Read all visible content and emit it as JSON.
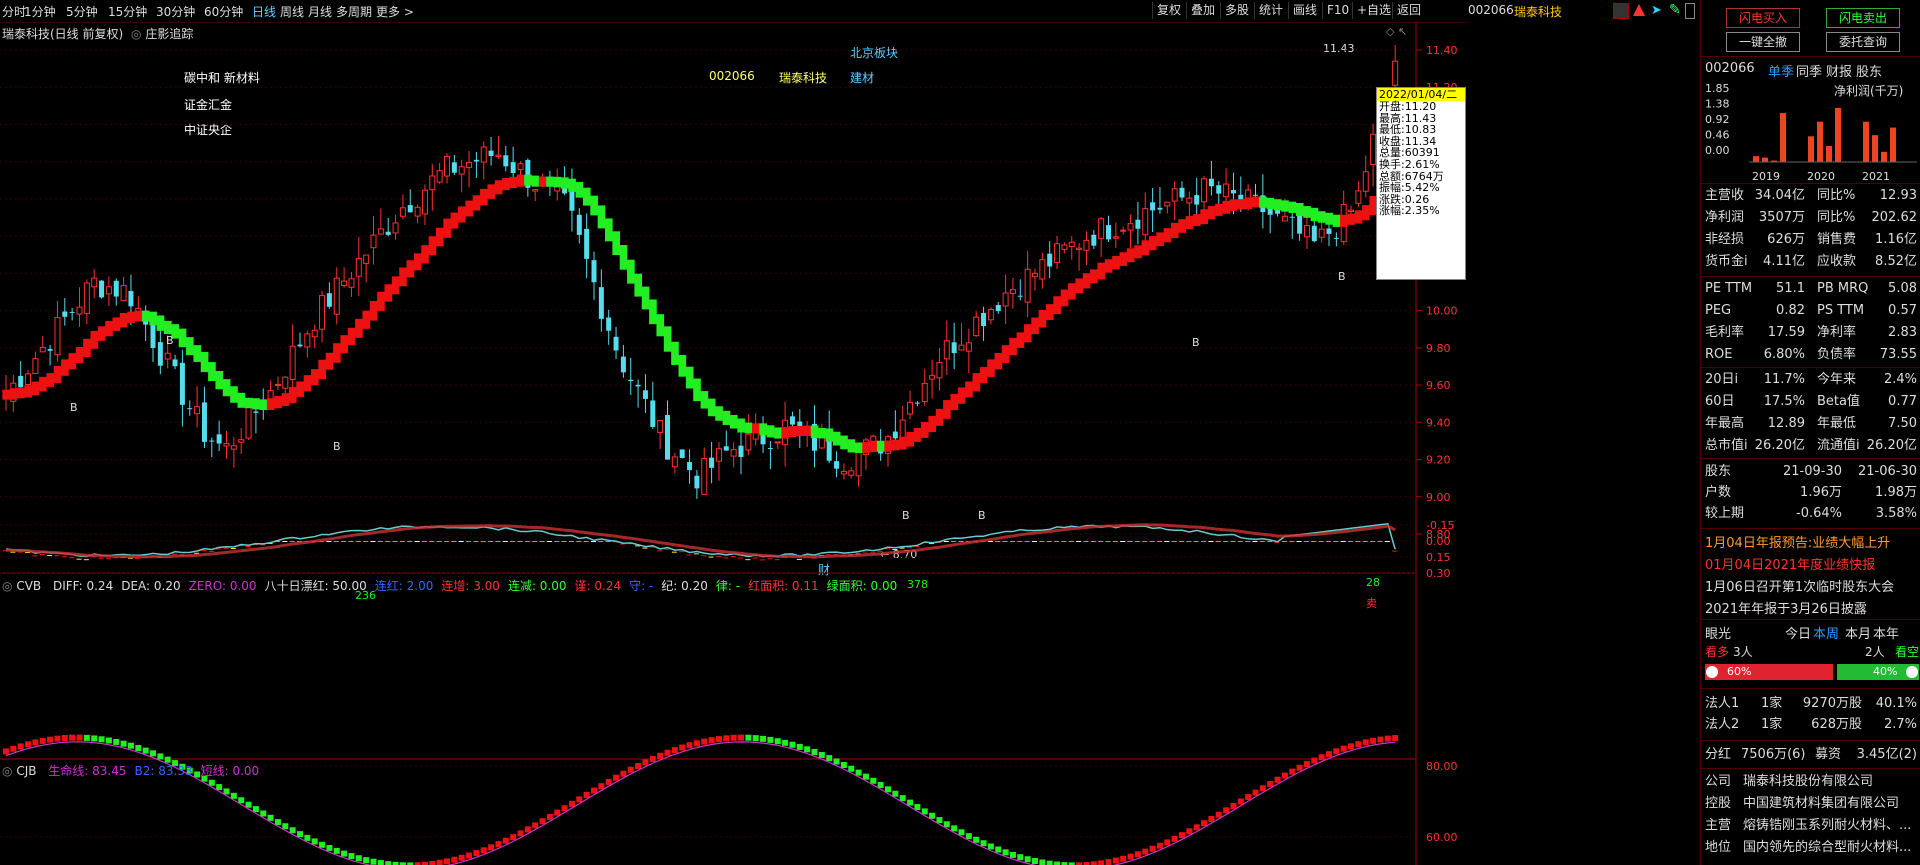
{
  "toolbar": {
    "periods": [
      "分时",
      "1分钟",
      "5分钟",
      "15分钟",
      "30分钟",
      "60分钟",
      "日线",
      "周线",
      "月线",
      "多周期",
      "更多 >"
    ],
    "right_buttons": [
      "复权",
      "叠加",
      "多股",
      "统计",
      "画线",
      "F10",
      "+自选",
      "返回"
    ],
    "stock_code": "002066",
    "stock_name": "瑞泰科技"
  },
  "main": {
    "title": "瑞泰科技(日线 前复权)",
    "zyzz": "庄影追踪",
    "tags_left": [
      "碳中和 新材料",
      "证金汇金",
      "中证央企"
    ],
    "tag_code": "002066",
    "tag_name": "瑞泰科技",
    "tag_sector": "建材",
    "tag_board": "北京板块",
    "high_label": "11.43",
    "low_label": "8.70",
    "cai_label": "财",
    "b_markers": [
      "B",
      "B",
      "B",
      "B",
      "B",
      "B",
      "B"
    ],
    "price_ticks": [
      "11.40",
      "11.20",
      "11.00",
      "10.80",
      "10.60",
      "10.40",
      "10.20",
      "10.00",
      "9.80",
      "9.60",
      "9.40",
      "9.20",
      "9.00",
      "8.80"
    ]
  },
  "tooltip": {
    "date": "2022/01/04/二",
    "rows": [
      "开盘:11.20",
      "最高:11.43",
      "最低:10.83",
      "收盘:11.34",
      "总量:60391",
      "换手:2.61%",
      "总额:6764万",
      "振幅:5.42%",
      "涨跌:0.26",
      "涨幅:2.35%"
    ]
  },
  "cvb": {
    "title": "CVB",
    "items": [
      {
        "t": "DIFF: 0.24",
        "c": "#dddddd"
      },
      {
        "t": "DEA: 0.20",
        "c": "#dddddd"
      },
      {
        "t": "ZERO: 0.00",
        "c": "#cc33cc"
      },
      {
        "t": "八十日漂红: 50.00",
        "c": "#dddddd"
      },
      {
        "t": "连红: 2.00",
        "c": "#3366ff"
      },
      {
        "t": "连增: 3.00",
        "c": "#ff3333"
      },
      {
        "t": "连减: 0.00",
        "c": "#33ff33"
      },
      {
        "t": "谨: 0.24",
        "c": "#ff3333"
      },
      {
        "t": "守: -",
        "c": "#3366ff"
      },
      {
        "t": "纪: 0.20",
        "c": "#dddddd"
      },
      {
        "t": "律: -",
        "c": "#33ff33"
      },
      {
        "t": "红面积: 0.11",
        "c": "#ff3333"
      },
      {
        "t": "绿面积: 0.00",
        "c": "#33ff33"
      }
    ],
    "ticks": [
      "0.30",
      "0.15",
      "0.00",
      "-0.15"
    ],
    "labels": [
      "236",
      "378",
      "28"
    ],
    "sell_label": "卖"
  },
  "cjb": {
    "title": "CJB",
    "items": [
      {
        "t": "生命线: 83.45",
        "c": "#cc33cc"
      },
      {
        "t": "B2: 83.33",
        "c": "#3366ff"
      },
      {
        "t": "短线: 0.00",
        "c": "#cc33cc"
      }
    ],
    "ticks": [
      "80.00",
      "60.00"
    ]
  },
  "panel": {
    "btn_buy": "闪电买入",
    "btn_sell": "闪电卖出",
    "btn_all": "一键全撤",
    "btn_query": "委托查询",
    "code": "002066",
    "tabs": [
      "单季",
      "同季",
      "财报",
      "股东"
    ],
    "chart_label": "净利润(千万)",
    "mini_y": [
      "1.85",
      "1.38",
      "0.92",
      "0.46",
      "0.00"
    ],
    "mini_x": [
      "2019",
      "2020",
      "2021"
    ],
    "fin": [
      [
        "主营收",
        "34.04亿",
        "同比%",
        "12.93"
      ],
      [
        "净利润",
        "3507万",
        "同比%",
        "202.62"
      ],
      [
        "非经损",
        "626万",
        "销售费",
        "1.16亿"
      ],
      [
        "货币金i",
        "4.11亿",
        "应收款",
        "8.52亿"
      ]
    ],
    "val": [
      [
        "PE TTM",
        "51.1",
        "PB MRQ",
        "5.08"
      ],
      [
        "PEG",
        "0.82",
        "PS TTM",
        "0.57"
      ],
      [
        "毛利率",
        "17.59",
        "净利率",
        "2.83"
      ],
      [
        "ROE",
        "6.80%",
        "负债率",
        "73.55"
      ]
    ],
    "perf": [
      [
        "20日i",
        "11.7%",
        "今年来",
        "2.4%"
      ],
      [
        "60日",
        "17.5%",
        "Beta值",
        "0.77"
      ],
      [
        "年最高",
        "12.89",
        "年最低",
        "7.50"
      ],
      [
        "总市值i",
        "26.20亿",
        "流通值i",
        "26.20亿"
      ]
    ],
    "holders": [
      [
        "股东",
        "21-09-30",
        "21-06-30"
      ],
      [
        "户数",
        "1.96万",
        "1.98万"
      ],
      [
        "较上期",
        "-0.64%",
        "3.58%"
      ]
    ],
    "news": [
      {
        "t": "1月04日年报预告:业绩大幅上升",
        "c": "#ff9933"
      },
      {
        "t": "01月04日2021年度业绩快报",
        "c": "#ff3333"
      },
      {
        "t": "1月06日召开第1次临时股东大会",
        "c": "#dddddd"
      },
      {
        "t": "2021年年报于3月26日披露",
        "c": "#dddddd"
      }
    ],
    "eye": {
      "label": "眼光",
      "tabs": [
        "今日",
        "本周",
        "本月",
        "本年"
      ],
      "bull": "看多",
      "bull_n": "3人",
      "bear_n": "2人",
      "bear": "看空",
      "bull_pct": "60%",
      "bear_pct": "40%"
    },
    "inst": [
      [
        "法人1",
        "1家",
        "9270万股",
        "40.1%"
      ],
      [
        "法人2",
        "1家",
        "628万股",
        "2.7%"
      ]
    ],
    "div": [
      "分红",
      "7506万(6)",
      "募资",
      "3.45亿(2)"
    ],
    "company": [
      [
        "公司",
        "瑞泰科技股份有限公司"
      ],
      [
        "控股",
        "中国建筑材料集团有限公司"
      ],
      [
        "主营",
        "熔铸锆刚玉系列耐火材料、..."
      ],
      [
        "地位",
        "国内领先的综合型耐火材料..."
      ]
    ]
  }
}
